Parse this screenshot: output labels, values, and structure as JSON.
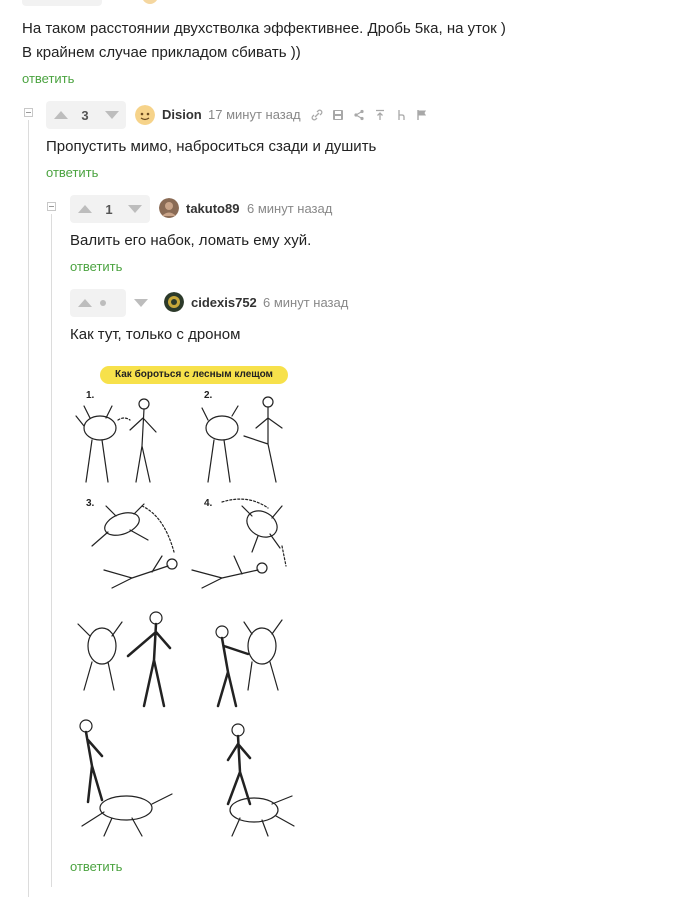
{
  "top_comment": {
    "lines": [
      "На таком расстоянии двухстволка эффективнее. Дробь 5ка, на уток )",
      "В крайнем случае прикладом сбивать ))"
    ],
    "reply_label": "ответить"
  },
  "comment1": {
    "score": "3",
    "username": "Dision",
    "time": "17 минут назад",
    "text": "Пропустить мимо, наброситься сзади и душить",
    "reply_label": "ответить"
  },
  "comment2": {
    "score": "1",
    "username": "takuto89",
    "time": "6 минут назад",
    "text": "Валить его набок, ломать ему хуй.",
    "reply_label": "ответить"
  },
  "comment3": {
    "username": "cidexis752",
    "time": "6 минут назад",
    "text": "Как тут, только с дроном",
    "image_title": "Как бороться с лесным клещом",
    "step_numbers": [
      "1.",
      "2.",
      "3.",
      "4."
    ],
    "reply_label": "ответить"
  },
  "colors": {
    "reply_green": "#4ba340",
    "title_yellow": "#f7e14b",
    "line_gray": "#dcdcdc"
  }
}
